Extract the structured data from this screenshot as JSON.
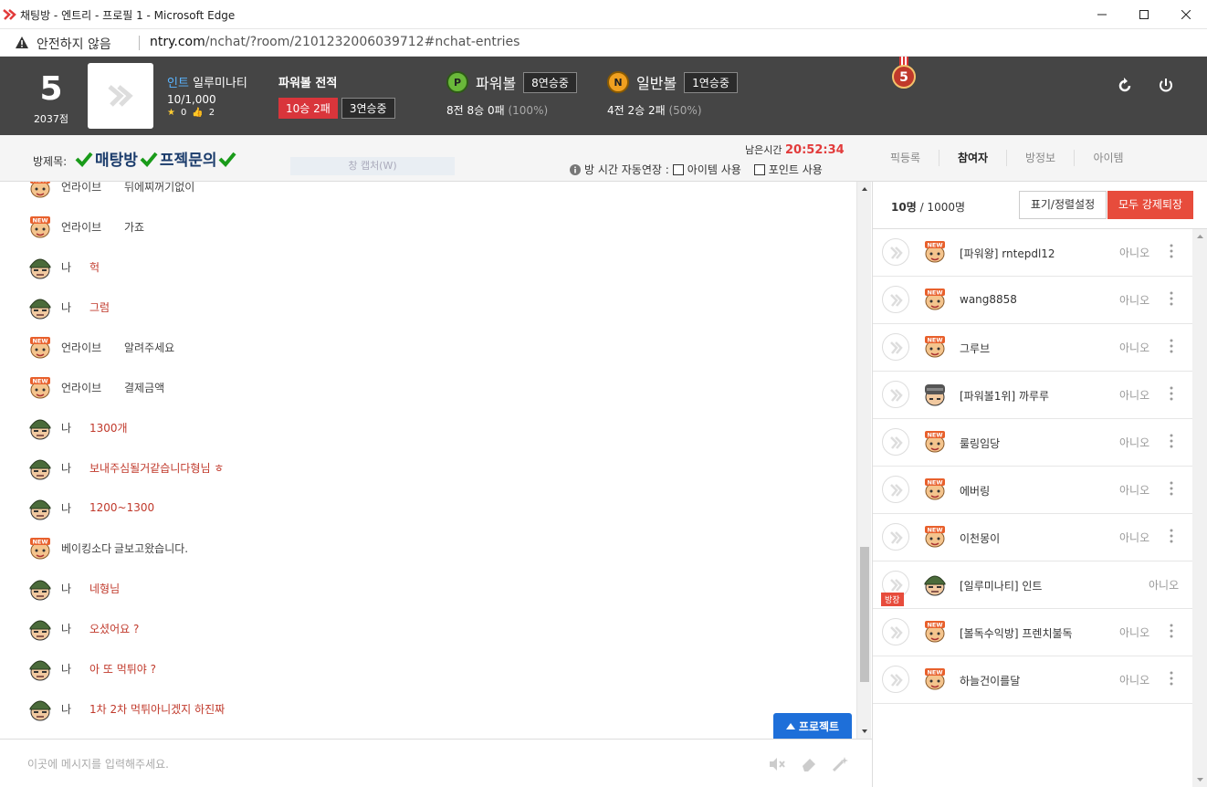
{
  "window": {
    "title": "채팅방 - 엔트리 - 프로필 1 - Microsoft Edge"
  },
  "address": {
    "warning": "안전하지 않음",
    "url_domain": "ntry.com",
    "url_path": "/nchat/?room/2101232006039712#nchat-entries"
  },
  "profile": {
    "level": "5",
    "points": "2037점",
    "tag": "인트",
    "name": "일루미나티",
    "exp": "10/1,000",
    "stars": "0",
    "likes": "2"
  },
  "record": {
    "title": "파워볼 전적",
    "winloss": "10승 2패",
    "streak": "3연승중"
  },
  "powerball": {
    "coin": "P",
    "label": "파워볼",
    "streak": "8연승중",
    "stats": "8전 8승 0패",
    "pct": "(100%)",
    "color": "#6ab83a"
  },
  "normalball": {
    "coin": "N",
    "label": "일반볼",
    "streak": "1연승중",
    "stats": "4전 2승 2패",
    "pct": "(50%)",
    "color": "#f0a020"
  },
  "medal": {
    "value": "5"
  },
  "room": {
    "label": "방제목:",
    "title_parts": [
      "매탕방",
      "프젝문의"
    ],
    "capture": "창 캡처(W)",
    "remain_label": "남은시간",
    "remain_time": "20:52:34",
    "extend_label": "방 시간 자동연장 :",
    "opt_item": "아이템 사용",
    "opt_point": "포인트 사용"
  },
  "tabs": [
    "픽등록",
    "참여자",
    "방정보",
    "아이템"
  ],
  "messages": [
    {
      "avatar": "new",
      "nick": "언라이브",
      "text": "뒤에찌꺼기없이",
      "mine": false
    },
    {
      "avatar": "new",
      "nick": "언라이브",
      "text": "가죠",
      "mine": false
    },
    {
      "avatar": "soldier",
      "nick": "나",
      "text": "헉",
      "mine": true
    },
    {
      "avatar": "soldier",
      "nick": "나",
      "text": "그럼",
      "mine": true
    },
    {
      "avatar": "new",
      "nick": "언라이브",
      "text": "알려주세요",
      "mine": false
    },
    {
      "avatar": "new",
      "nick": "언라이브",
      "text": "결제금액",
      "mine": false
    },
    {
      "avatar": "soldier",
      "nick": "나",
      "text": "1300개",
      "mine": true
    },
    {
      "avatar": "soldier",
      "nick": "나",
      "text": "보내주심될거같습니다형님 ㅎ",
      "mine": true
    },
    {
      "avatar": "soldier",
      "nick": "나",
      "text": "1200~1300",
      "mine": true
    },
    {
      "avatar": "new",
      "nick": "베이킹소다",
      "text": "글보고왔습니다.",
      "mine": false
    },
    {
      "avatar": "soldier",
      "nick": "나",
      "text": "네형님",
      "mine": true
    },
    {
      "avatar": "soldier",
      "nick": "나",
      "text": "오셨어요 ?",
      "mine": true
    },
    {
      "avatar": "soldier",
      "nick": "나",
      "text": "아 또 먹튀야 ?",
      "mine": true
    },
    {
      "avatar": "soldier",
      "nick": "나",
      "text": "1차 2차 먹튀아니겠지 하진짜",
      "mine": true
    }
  ],
  "project_button": "프로젝트",
  "input": {
    "placeholder": "이곳에 메시지를 입력해주세요."
  },
  "participants": {
    "count": "10명",
    "max": "/ 1000명",
    "display_button": "표기/정렬설정",
    "kick_button": "모두 강제퇴장",
    "owner_tag": "방장",
    "items": [
      {
        "avatar": "new",
        "name": "[파워왕] rntepdl12",
        "status": "아니오",
        "owner": false
      },
      {
        "avatar": "new",
        "name": "wang8858",
        "status": "아니오",
        "owner": false
      },
      {
        "avatar": "new",
        "name": "그루브",
        "status": "아니오",
        "owner": false
      },
      {
        "avatar": "helmet",
        "name": "[파워볼1위] 까루루",
        "status": "아니오",
        "owner": false
      },
      {
        "avatar": "new",
        "name": "룰링임당",
        "status": "아니오",
        "owner": false
      },
      {
        "avatar": "new",
        "name": "에버링",
        "status": "아니오",
        "owner": false
      },
      {
        "avatar": "new",
        "name": "이천몽이",
        "status": "아니오",
        "owner": false
      },
      {
        "avatar": "soldier",
        "name": "[일루미나티] 인트",
        "status": "아니오",
        "owner": true
      },
      {
        "avatar": "new",
        "name": "[볼독수익방] 프렌치불독",
        "status": "아니오",
        "owner": false
      },
      {
        "avatar": "new",
        "name": "하늘건이를달",
        "status": "아니오",
        "owner": false
      }
    ]
  },
  "colors": {
    "topbar": "#454545",
    "accent_red": "#e74c3c",
    "accent_blue": "#1e6fd9",
    "room_title": "#1a3b6b"
  }
}
